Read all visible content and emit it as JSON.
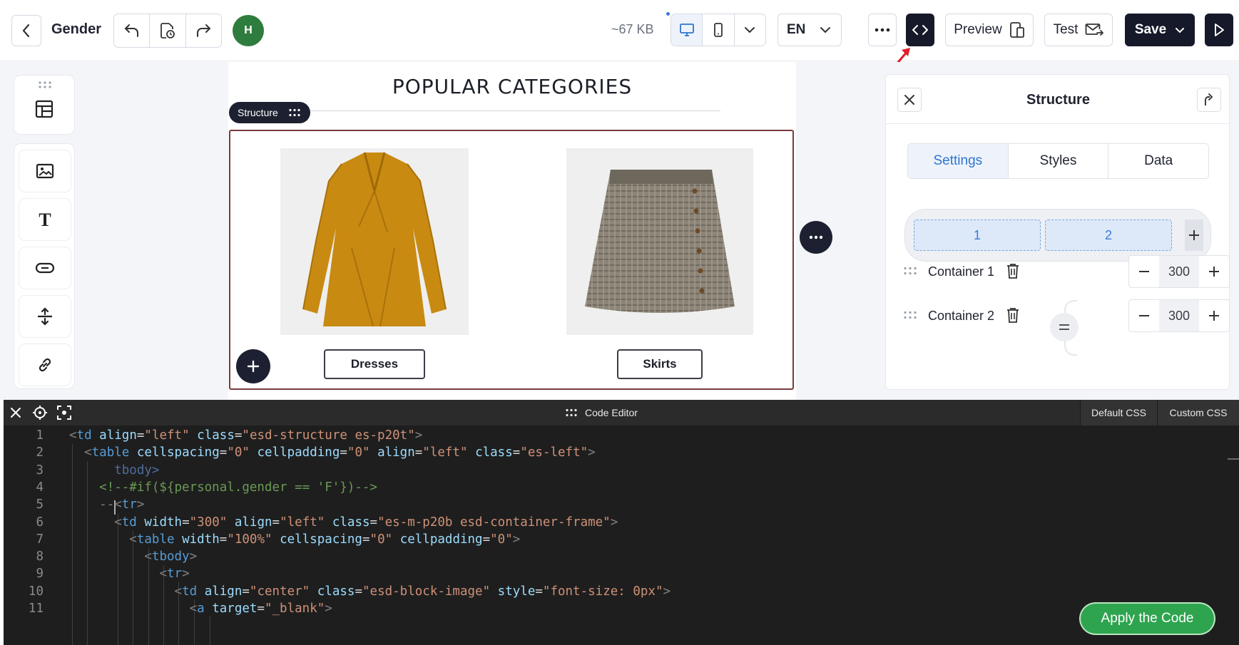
{
  "toolbar": {
    "title": "Gender",
    "avatar_initial": "H",
    "size_label": "~67 KB",
    "language": "EN",
    "preview_label": "Preview",
    "test_label": "Test",
    "save_label": "Save"
  },
  "canvas": {
    "heading": "POPULAR CATEGORIES",
    "structure_tag": "Structure",
    "products": [
      {
        "label": "Dresses",
        "image": "orange-dress-image"
      },
      {
        "label": "Skirts",
        "image": "plaid-skirt-image"
      }
    ]
  },
  "panel": {
    "title": "Structure",
    "tabs": [
      "Settings",
      "Styles",
      "Data"
    ],
    "active_tab": "Settings",
    "columns": [
      "1",
      "2"
    ],
    "containers": [
      {
        "label": "Container 1",
        "width": "300"
      },
      {
        "label": "Container 2",
        "width": "300"
      }
    ]
  },
  "editor": {
    "title": "Code Editor",
    "default_css_label": "Default CSS",
    "custom_css_label": "Custom CSS",
    "apply_label": "Apply the Code",
    "lines": [
      "<td align=\"left\" class=\"esd-structure es-p20t\">",
      "  <table cellspacing=\"0\" cellpadding=\"0\" align=\"left\" class=\"es-left\">",
      "      tbody>",
      "    <!--#if(${personal.gender == 'F'})-->",
      "    --<tr>",
      "      <td width=\"300\" align=\"left\" class=\"es-m-p20b esd-container-frame\">",
      "        <table width=\"100%\" cellspacing=\"0\" cellpadding=\"0\">",
      "          <tbody>",
      "            <tr>",
      "              <td align=\"center\" class=\"esd-block-image\" style=\"font-size: 0px\">",
      "                <a target=\"_blank\">"
    ]
  },
  "colors": {
    "accent_blue": "#2f74d0",
    "dark": "#15192a",
    "avatar_green": "#2e7d3e",
    "apply_green": "#2ea44f",
    "frame_border": "#7a3a3f"
  }
}
